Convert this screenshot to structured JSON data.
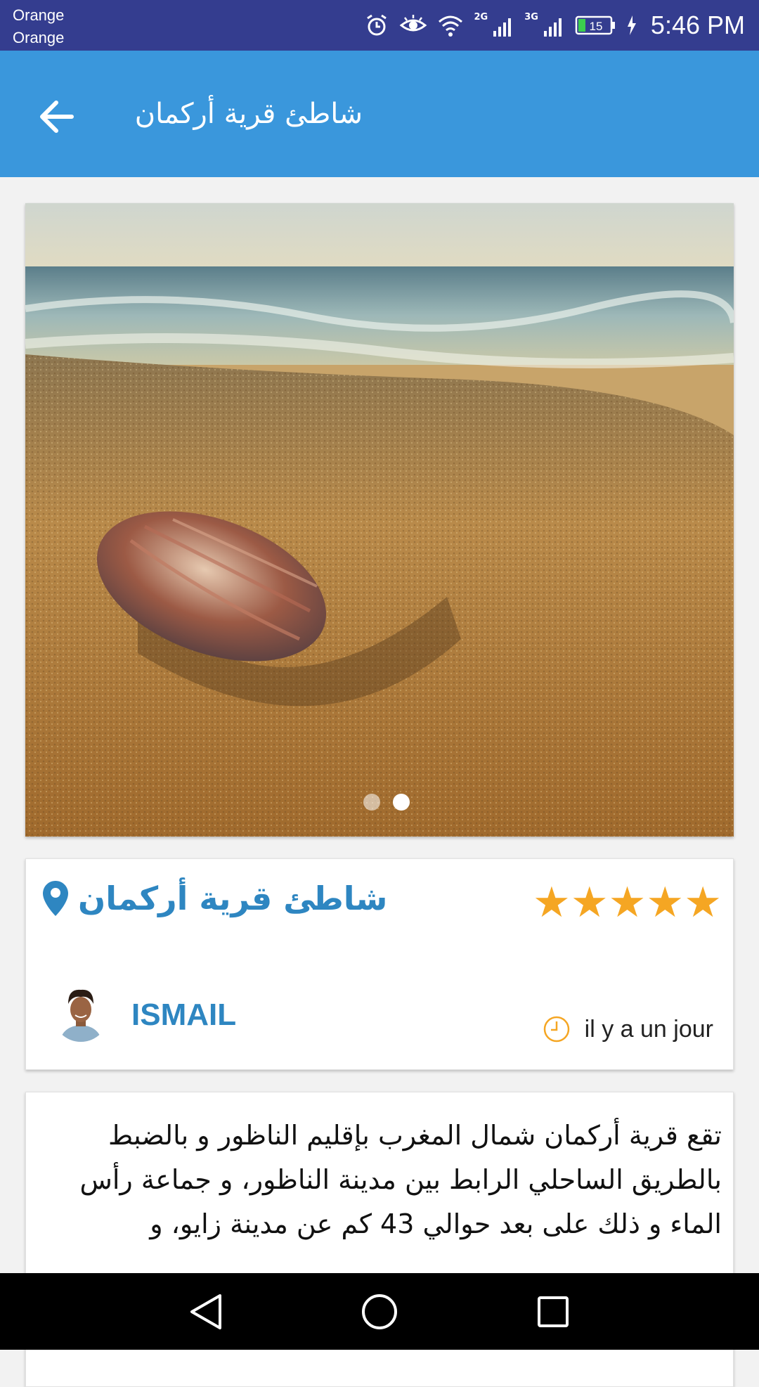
{
  "status_bar": {
    "carrier_line1": "Orange",
    "carrier_line2": "Orange",
    "net_tag_1": "2G",
    "net_tag_2": "3G",
    "battery": "15",
    "time": "5:46 PM"
  },
  "app_bar": {
    "title": "شاطئ قرية أركمان",
    "back_icon": "arrow-left-icon"
  },
  "gallery": {
    "image_subject": "seashell on sandy beach",
    "page_count": 2,
    "active_page": 2
  },
  "place": {
    "name": "شاطئ قرية أركمان",
    "rating": 5,
    "rating_max": 5,
    "star_glyph": "★",
    "author": "ISMAIL",
    "posted_time": "il y a un jour"
  },
  "description": {
    "text": "تقع قرية أركمان شمال المغرب بإقليم الناظور و بالضبط بالطريق الساحلي الرابط بين مدينة الناظور، و جماعة رأس الماء و ذلك على بعد حوالي 43 كم عن مدينة زايو، و"
  },
  "colors": {
    "status_bar": "#343d8f",
    "app_bar": "#3a97dc",
    "accent_text": "#2e86c1",
    "star": "#f5a623"
  }
}
